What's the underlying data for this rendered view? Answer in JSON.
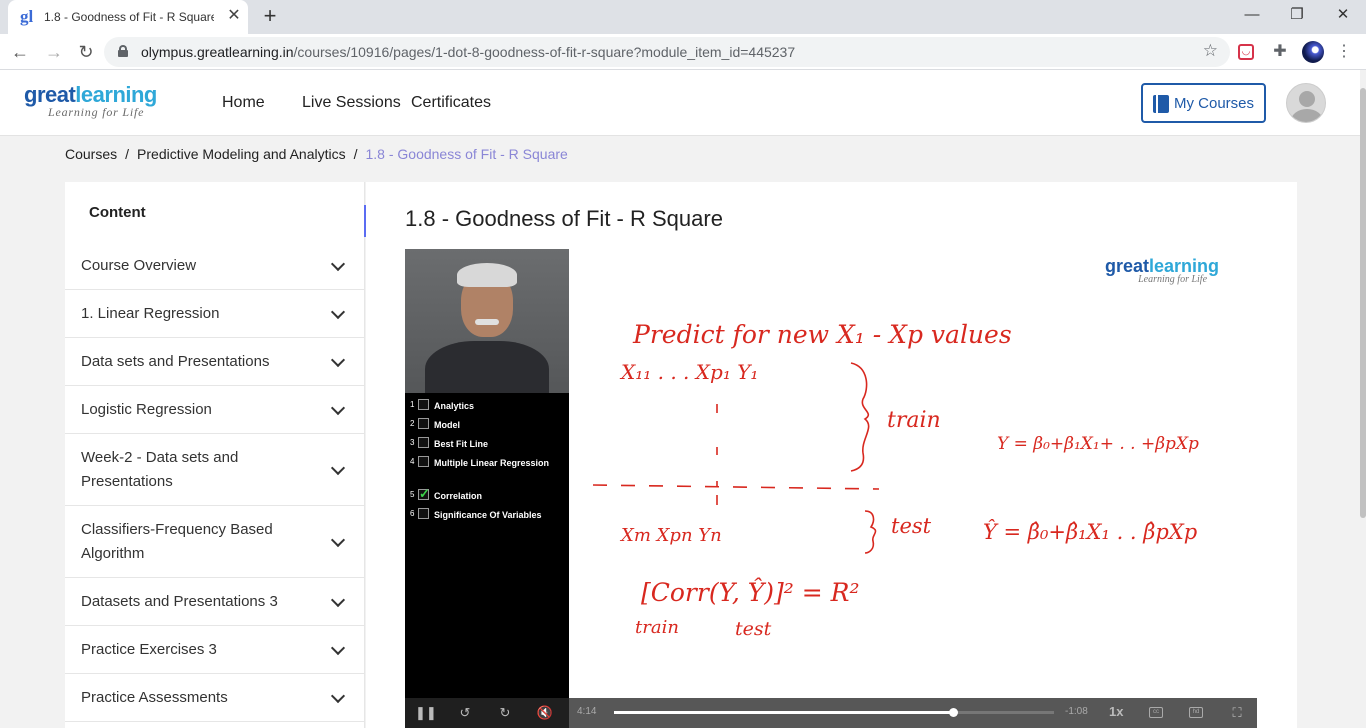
{
  "browser": {
    "tab_title": "1.8 - Goodness of Fit - R Square",
    "tab_favicon": "gl-icon",
    "url_host": "olympus.greatlearning.in",
    "url_path": "/courses/10916/pages/1-dot-8-goodness-of-fit-r-square?module_item_id=445237"
  },
  "header": {
    "logo_part1": "great",
    "logo_part2": "learning",
    "logo_tagline": "Learning for Life",
    "nav": [
      "Home",
      "Live Sessions",
      "Certificates"
    ],
    "my_courses": "My Courses"
  },
  "breadcrumb": {
    "items": [
      "Courses",
      "Predictive Modeling and Analytics"
    ],
    "current": "1.8 - Goodness of Fit - R Square",
    "separator": "/"
  },
  "sidebar": {
    "title": "Content",
    "collapse_label": "«",
    "items": [
      {
        "label": "Course Overview"
      },
      {
        "label": "1. Linear Regression"
      },
      {
        "label": "Data sets and Presentations"
      },
      {
        "label": "Logistic Regression"
      },
      {
        "label": "Week-2 - Data sets and Presentations"
      },
      {
        "label": "Classifiers-Frequency Based Algorithm"
      },
      {
        "label": "Datasets and Presentations 3"
      },
      {
        "label": "Practice Exercises 3"
      },
      {
        "label": "Practice Assessments"
      }
    ]
  },
  "main": {
    "page_title": "1.8 - Goodness of Fit - R Square"
  },
  "video": {
    "toc": [
      {
        "num": "1",
        "label": "Analytics",
        "done": false
      },
      {
        "num": "2",
        "label": "Model",
        "done": false
      },
      {
        "num": "3",
        "label": "Best Fit Line",
        "done": false
      },
      {
        "num": "4",
        "label": "Multiple Linear Regression",
        "done": false
      },
      {
        "num": "5",
        "label": "Correlation",
        "done": true
      },
      {
        "num": "6",
        "label": "Significance Of Variables",
        "done": false
      }
    ],
    "board_logo_part1": "great",
    "board_logo_part2": "learning",
    "board_logo_tagline": "Learning for Life",
    "handwriting": {
      "line1": "Predict for new X₁ - Xp values",
      "line2": "X₁₁ . . . Xp₁  Y₁",
      "train": "train",
      "eq_train": "Y = β₀+β₁X₁+ . . +βpXp",
      "line3": "Xm  Xpn  Yn",
      "test": "test",
      "eq_test": "Ŷ = β̂₀+β̂₁X₁ . . β̂pXp",
      "corr": "[Corr(Y, Ŷ)]² = R²",
      "bottom_left": "train",
      "bottom_right": "test"
    },
    "elapsed": "4:14",
    "remaining": "-1:08",
    "progress": 0.77,
    "speed": "1x",
    "ink_color": "#d8281f"
  }
}
